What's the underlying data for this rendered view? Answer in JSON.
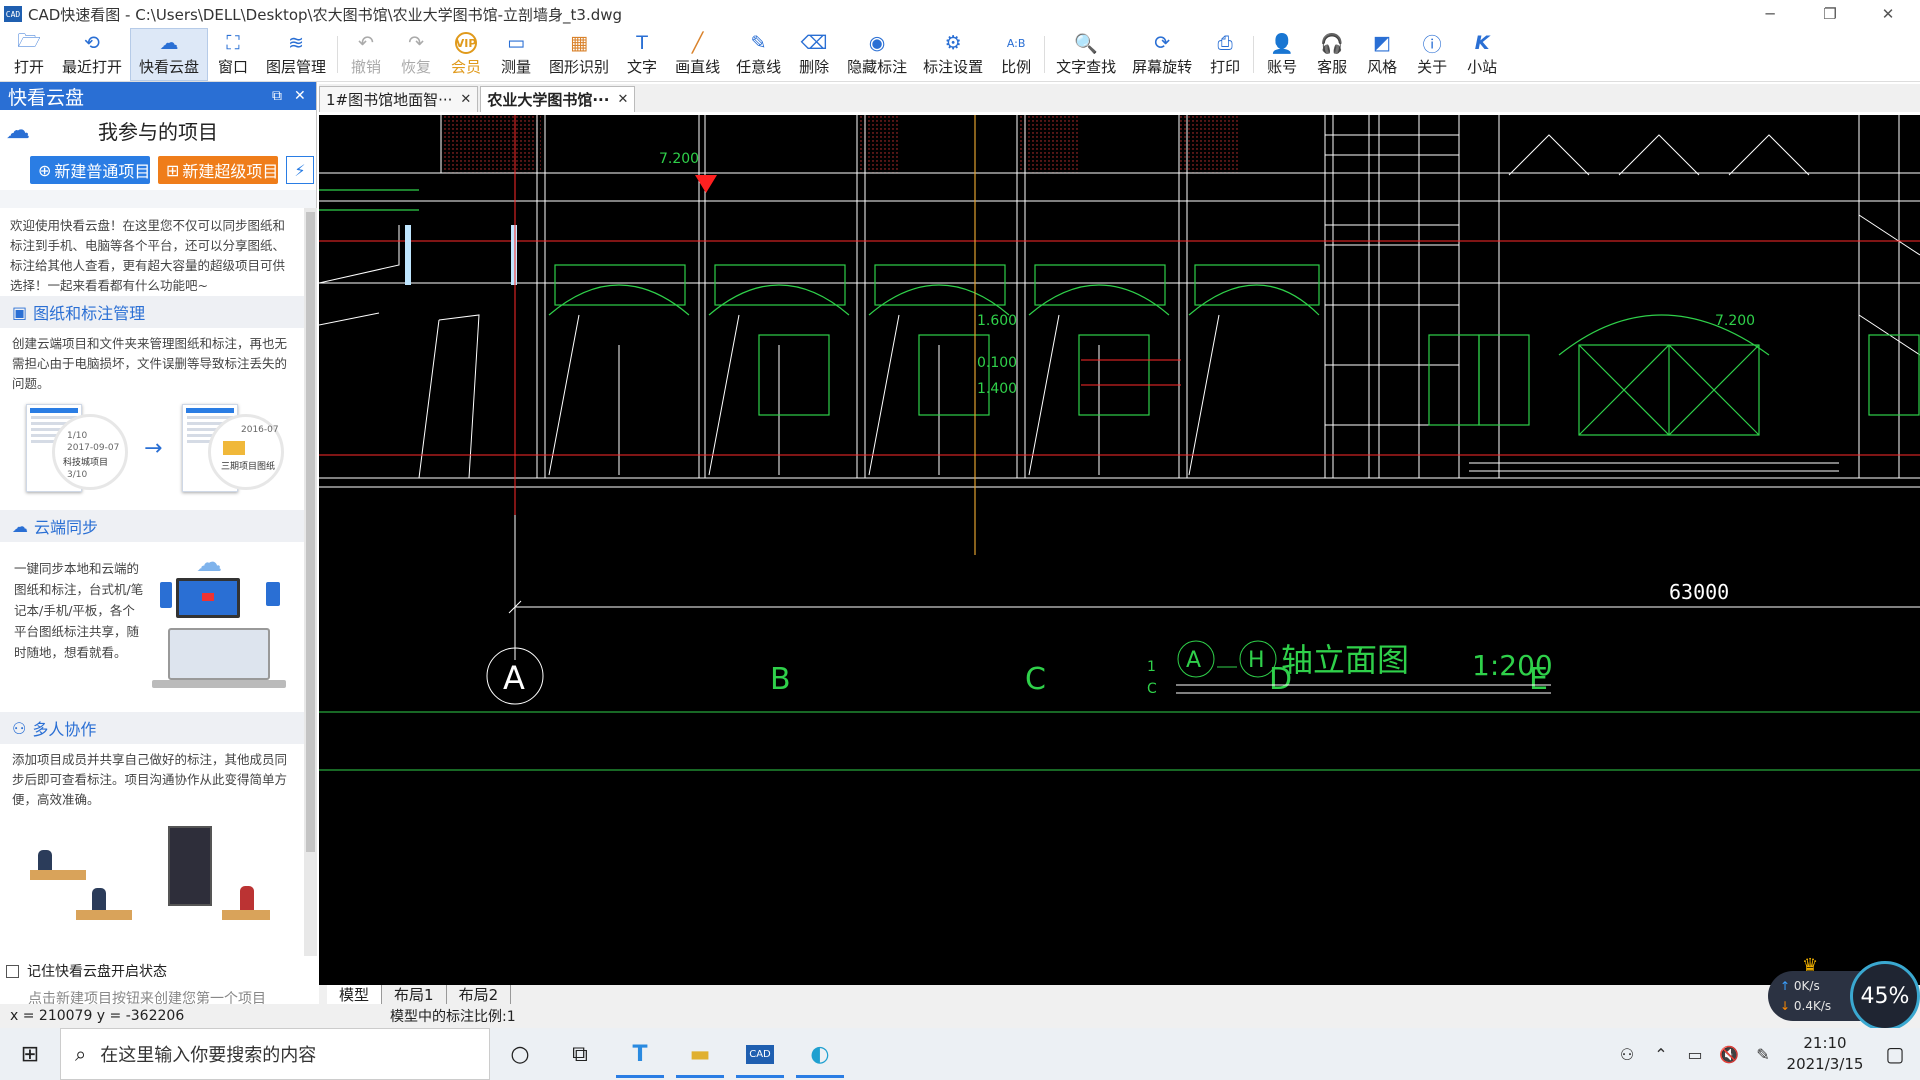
{
  "window": {
    "title": "CAD快速看图 - C:\\Users\\DELL\\Desktop\\农大图书馆\\农业大学图书馆-立剖墙身_t3.dwg",
    "app_icon": "CAD"
  },
  "toolbar": {
    "items": [
      {
        "label": "打开",
        "icon": "folder-open-icon"
      },
      {
        "label": "最近打开",
        "icon": "clock-icon"
      },
      {
        "label": "快看云盘",
        "icon": "cloud-icon"
      },
      {
        "label": "窗口",
        "icon": "window-icon"
      },
      {
        "label": "图层管理",
        "icon": "layers-icon"
      },
      {
        "label": "撤销",
        "icon": "undo-icon"
      },
      {
        "label": "恢复",
        "icon": "redo-icon"
      },
      {
        "label": "会员",
        "icon": "vip-icon"
      },
      {
        "label": "测量",
        "icon": "ruler-icon"
      },
      {
        "label": "图形识别",
        "icon": "shape-recognition-icon"
      },
      {
        "label": "文字",
        "icon": "text-icon"
      },
      {
        "label": "画直线",
        "icon": "line-icon"
      },
      {
        "label": "任意线",
        "icon": "freehand-icon"
      },
      {
        "label": "删除",
        "icon": "eraser-icon"
      },
      {
        "label": "隐藏标注",
        "icon": "eye-hidden-icon"
      },
      {
        "label": "标注设置",
        "icon": "annotation-settings-icon"
      },
      {
        "label": "比例",
        "icon": "scale-icon"
      },
      {
        "label": "文字查找",
        "icon": "text-search-icon"
      },
      {
        "label": "屏幕旋转",
        "icon": "rotate-screen-icon"
      },
      {
        "label": "打印",
        "icon": "printer-icon"
      },
      {
        "label": "账号",
        "icon": "user-icon"
      },
      {
        "label": "客服",
        "icon": "headset-icon"
      },
      {
        "label": "风格",
        "icon": "style-icon"
      },
      {
        "label": "关于",
        "icon": "info-icon"
      },
      {
        "label": "小站",
        "icon": "site-icon"
      }
    ],
    "vip_badge": "VIP"
  },
  "panel": {
    "title": "快看云盘",
    "project_heading": "我参与的项目",
    "new_normal": "新建普通项目",
    "new_super": "新建超级项目",
    "intro": "欢迎使用快看云盘！在这里您不仅可以同步图纸和标注到手机、电脑等各个平台，还可以分享图纸、标注给其他人查看，更有超大容量的超级项目可供选择！一起来看看都有什么功能吧~",
    "sections": [
      {
        "title": "图纸和标注管理",
        "text": "创建云端项目和文件夹来管理图纸和标注，再也无需担心由于电脑损坏，文件误删等导致标注丢失的问题。"
      },
      {
        "title": "云端同步",
        "text": "一键同步本地和云端的图纸和标注，台式机/笔记本/手机/平板，各个平台图纸标注共享，随时随地，想看就看。"
      },
      {
        "title": "多人协作",
        "text": "添加项目成员并共享自己做好的标注，其他成员同步后即可查看标注。项目沟通协作从此变得简单方便，高效准确。"
      }
    ],
    "illus_labels": [
      "科技城项目",
      "三期项目图纸",
      "3/10",
      "1/10",
      "2017-09-07",
      "2016-07"
    ],
    "remember_label": "记住快看云盘开启状态",
    "footer_hint": "点击新建项目按钮来创建您第一个项目"
  },
  "doc_tabs": [
    {
      "label": "1#图书馆地面智···",
      "active": false
    },
    {
      "label": "农业大学图书馆···",
      "active": true
    }
  ],
  "drawing": {
    "dim_total": "63000",
    "axes": [
      "A",
      "B",
      "C",
      "D",
      "E"
    ],
    "title_axis_a": "A",
    "title_axis_h": "H",
    "title_text": "轴立面图",
    "scale": "1:200",
    "elev_labels": [
      "7.200",
      "1.600",
      "0.100",
      "1.400",
      "7.200"
    ],
    "frac": [
      "1",
      "C"
    ]
  },
  "layout_tabs": [
    "模型",
    "布局1",
    "布局2"
  ],
  "status": {
    "coords": "x = 210079 y = -362206",
    "scale_text": "模型中的标注比例:1"
  },
  "network": {
    "up": "0K/s",
    "down": "0.4K/s",
    "percent": "45%"
  },
  "taskbar": {
    "search_placeholder": "在这里输入你要搜索的内容",
    "time": "21:10",
    "date": "2021/3/15"
  },
  "colors": {
    "accent": "#2a6fd4",
    "orange": "#ef7d1a",
    "cad_bg": "#000000",
    "cad_line": "#ffffff",
    "cad_green": "#2fd04a",
    "cad_red": "#ff2a2a"
  }
}
